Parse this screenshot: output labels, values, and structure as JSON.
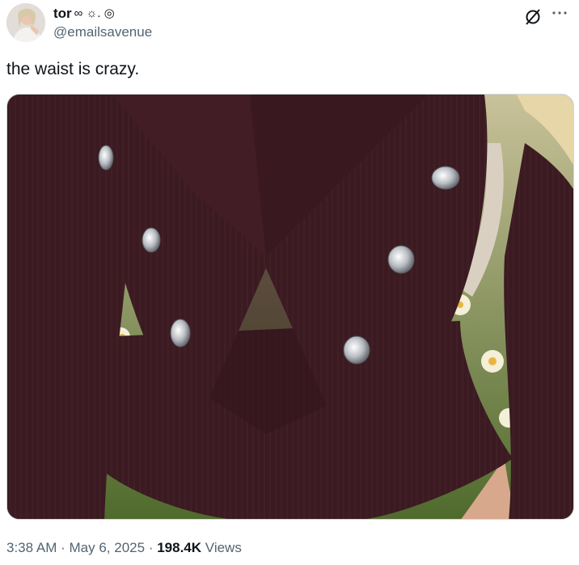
{
  "tweet": {
    "author": {
      "display_name": "tor",
      "name_emojis": "∞ ☼. ◎",
      "handle": "@emailsavenue",
      "avatar_icon": "avatar-photo"
    },
    "text": "the waist is crazy.",
    "media": {
      "description_icon": "photo-suit-waist"
    },
    "time": "3:38 AM",
    "date": "May 6, 2025",
    "views_count": "198.4K",
    "views_label": "Views",
    "separator": "·"
  },
  "colors": {
    "text_primary": "#0f1419",
    "text_secondary": "#536471",
    "suit": "#3a1a20"
  },
  "icons": [
    "grok-icon",
    "more-icon"
  ]
}
